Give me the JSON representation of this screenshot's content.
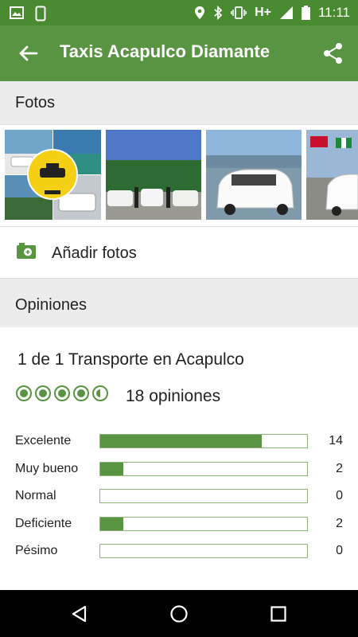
{
  "status_bar": {
    "time": "11:11",
    "network": "H+"
  },
  "app_bar": {
    "title": "Taxis Acapulco Diamante"
  },
  "photos_section": {
    "title": "Fotos"
  },
  "add_photos": {
    "label": "Añadir fotos"
  },
  "opinions_section": {
    "title": "Opiniones"
  },
  "ranking": {
    "text": "1 de 1 Transporte en Acapulco"
  },
  "rating": {
    "bubbles": 4.5,
    "reviews_count_text": "18 opiniones",
    "accent": "#589442"
  },
  "distribution": [
    {
      "label": "Excelente",
      "count": "14",
      "fraction": 0.78
    },
    {
      "label": "Muy bueno",
      "count": "2",
      "fraction": 0.11
    },
    {
      "label": "Normal",
      "count": "0",
      "fraction": 0
    },
    {
      "label": "Deficiente",
      "count": "2",
      "fraction": 0.11
    },
    {
      "label": "Pésimo",
      "count": "0",
      "fraction": 0
    }
  ]
}
